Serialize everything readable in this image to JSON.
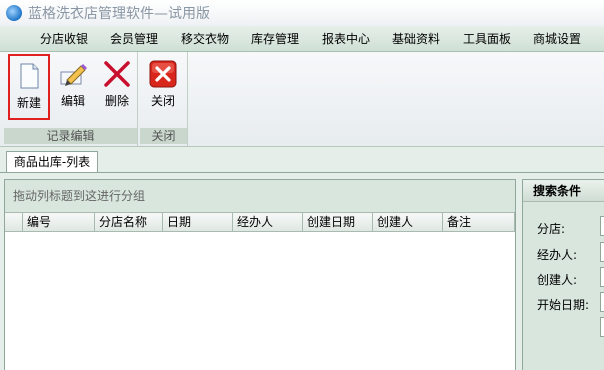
{
  "window": {
    "title": "蓝格洗衣店管理软件—试用版"
  },
  "menu": {
    "items": [
      "分店收银",
      "会员管理",
      "移交衣物",
      "库存管理",
      "报表中心",
      "基础资料",
      "工具面板",
      "商城设置"
    ]
  },
  "ribbon": {
    "groups": [
      {
        "label": "记录编辑",
        "buttons": [
          "新建",
          "编辑",
          "删除"
        ]
      },
      {
        "label": "关闭",
        "buttons": [
          "关闭"
        ]
      }
    ]
  },
  "tabs": [
    {
      "label": "商品出库-列表"
    }
  ],
  "grid": {
    "group_hint": "拖动列标题到这进行分组",
    "columns": [
      "编号",
      "分店名称",
      "日期",
      "经办人",
      "创建日期",
      "创建人",
      "备注"
    ]
  },
  "search": {
    "title": "搜索条件",
    "fields": [
      "分店:",
      "经办人:",
      "创建人:",
      "开始日期:"
    ]
  },
  "colors": {
    "delete_icon": "#c8102e",
    "close_icon": "#d9261c",
    "selection_border": "#e02020"
  }
}
